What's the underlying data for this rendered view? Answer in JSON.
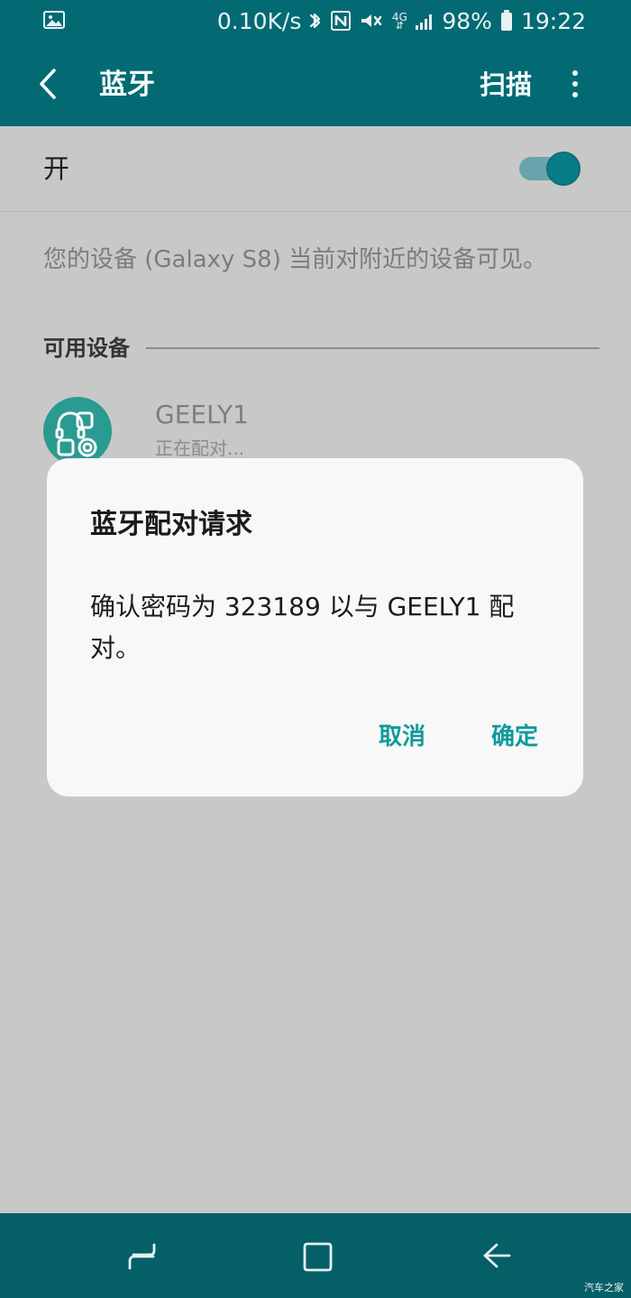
{
  "status_bar": {
    "network_speed": "0.10K/s",
    "network_type": "4G",
    "battery": "98%",
    "time": "19:22",
    "icons": [
      "image-icon",
      "bluetooth-icon",
      "nfc-icon",
      "vibrate-icon",
      "signal-icon",
      "battery-icon"
    ]
  },
  "app_bar": {
    "title": "蓝牙",
    "scan_label": "扫描"
  },
  "settings": {
    "toggle_label": "开",
    "visibility_text": "您的设备 (Galaxy S8) 当前对附近的设备可见。",
    "available_devices_title": "可用设备",
    "device": {
      "name": "GEELY1",
      "status": "正在配对..."
    }
  },
  "dialog": {
    "title": "蓝牙配对请求",
    "message": "确认密码为 323189 以与 GEELY1 配对。",
    "cancel_label": "取消",
    "confirm_label": "确定"
  },
  "navigation": {
    "recents": "recents-icon",
    "home": "home-icon",
    "back": "back-icon"
  },
  "watermark": "汽车之家",
  "colors": {
    "header": "#036a73",
    "overlay_background": "#c8c8c8",
    "dialog_background": "#f8f8f8",
    "accent": "#109a9a",
    "device_icon": "#2a9b90"
  }
}
